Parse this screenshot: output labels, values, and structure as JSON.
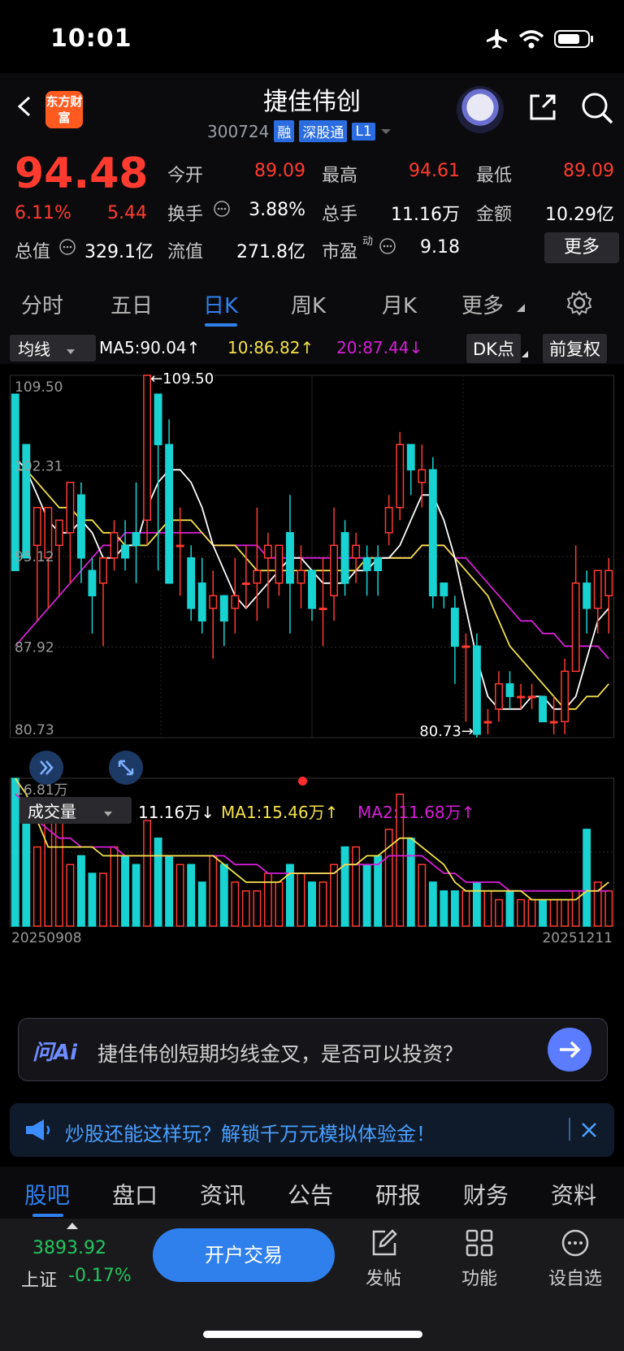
{
  "status_bar": {
    "time": "10:01"
  },
  "header": {
    "logo_text": "东方财富",
    "title": "捷佳伟创",
    "code": "300724",
    "badges": [
      "融",
      "深股通",
      "L1"
    ]
  },
  "quote": {
    "price": "94.48",
    "change_pct": "6.11%",
    "change": "5.44",
    "market_cap_label": "总值",
    "market_cap": "329.1亿",
    "rows": [
      [
        {
          "label": "今开",
          "value": "89.09",
          "color": "#ff3b30"
        },
        {
          "label": "最高",
          "value": "94.61",
          "color": "#ff3b30"
        },
        {
          "label": "最低",
          "value": "89.09",
          "color": "#ff3b30"
        }
      ],
      [
        {
          "label": "换手",
          "value": "3.88%",
          "color": "#ffffff"
        },
        {
          "label": "总手",
          "value": "11.16万",
          "color": "#ffffff"
        },
        {
          "label": "金额",
          "value": "10.29亿",
          "color": "#ffffff"
        }
      ],
      [
        {
          "label": "流值",
          "value": "271.8亿",
          "color": "#ffffff"
        },
        {
          "label": "市盈",
          "value": "9.18",
          "color": "#ffffff"
        }
      ]
    ],
    "pe_superscript": "动",
    "more_label": "更多"
  },
  "kline_tabs": [
    "分时",
    "五日",
    "日K",
    "周K",
    "月K",
    "更多"
  ],
  "kline_active": "日K",
  "ma_legend": {
    "selector": "均线",
    "ma5": "MA5:90.04↑",
    "ma10": "10:86.82↑",
    "ma20": "20:87.44↓",
    "dk_label": "DK点",
    "adjust_label": "前复权"
  },
  "volume_legend": {
    "selector": "成交量",
    "vol": "11.16万↓",
    "ma1": "MA1:15.46万↑",
    "ma2": "MA2:11.68万↑"
  },
  "chart_data": {
    "type": "candlestick",
    "price_axis_labels": [
      "109.50",
      "102.31",
      "95.12",
      "87.92",
      "80.73"
    ],
    "price_range": [
      80.73,
      109.5
    ],
    "annotations": {
      "high": "←109.50",
      "low": "80.73→"
    },
    "volume_axis_label": "16.81万",
    "volume_max": 16.81,
    "date_start": "20250908",
    "date_end": "20251211",
    "colors": {
      "up": "#ff3b30",
      "down": "#19d3d3",
      "ma5": "#ffffff",
      "ma10": "#f3e24b",
      "ma20": "#d61fd6"
    },
    "candles": [
      [
        108,
        94,
        104,
        94
      ],
      [
        104,
        95,
        98,
        96
      ],
      [
        96,
        99,
        98,
        90
      ],
      [
        95,
        99,
        96,
        91
      ],
      [
        96,
        98,
        96,
        92
      ],
      [
        97,
        101,
        98,
        93
      ],
      [
        100,
        95,
        101,
        93
      ],
      [
        94,
        92,
        95,
        89
      ],
      [
        93,
        95,
        95,
        88
      ],
      [
        95,
        97,
        98,
        94
      ],
      [
        96,
        95,
        98,
        94
      ],
      [
        97,
        96,
        101,
        93
      ],
      [
        98,
        109.5,
        109.5,
        96
      ],
      [
        108,
        104,
        108,
        94
      ],
      [
        104,
        93,
        106,
        93
      ],
      [
        96,
        96,
        99,
        92
      ],
      [
        95,
        91,
        96,
        90
      ],
      [
        93,
        90,
        95,
        89
      ],
      [
        91,
        92,
        94,
        87
      ],
      [
        92,
        90,
        92,
        88
      ],
      [
        91,
        92,
        95,
        89
      ],
      [
        93,
        93,
        96,
        91
      ],
      [
        93,
        94,
        99,
        90
      ],
      [
        95,
        96,
        97,
        91
      ],
      [
        93,
        96,
        96,
        92
      ],
      [
        97,
        93,
        100,
        89
      ],
      [
        93,
        94,
        96,
        91
      ],
      [
        94,
        91,
        94,
        90
      ],
      [
        91,
        91,
        95,
        88
      ],
      [
        92,
        96,
        99,
        90
      ],
      [
        97,
        93,
        98,
        92
      ],
      [
        95,
        96,
        97,
        93
      ],
      [
        95,
        94,
        96,
        92
      ],
      [
        95,
        94,
        96,
        92
      ],
      [
        97,
        99,
        100,
        96
      ],
      [
        99,
        104,
        105,
        98
      ],
      [
        104,
        102,
        104,
        100
      ],
      [
        101,
        102,
        104,
        99
      ],
      [
        102,
        92,
        103,
        91
      ],
      [
        93,
        92,
        93,
        91
      ],
      [
        91,
        88,
        92,
        85
      ],
      [
        88,
        88,
        89,
        82
      ],
      [
        88,
        81,
        89,
        80.73
      ],
      [
        82,
        82,
        83,
        81
      ],
      [
        83,
        85,
        86,
        82
      ],
      [
        85,
        84,
        86,
        83
      ],
      [
        84,
        84,
        85,
        83
      ],
      [
        84,
        84,
        85,
        83
      ],
      [
        84,
        82,
        84,
        82
      ],
      [
        82,
        82,
        84,
        81
      ],
      [
        82,
        86,
        87,
        81
      ],
      [
        86,
        93,
        96,
        86
      ],
      [
        93,
        91,
        94,
        89
      ],
      [
        91,
        94,
        94,
        89
      ],
      [
        92,
        94,
        95,
        89
      ]
    ],
    "ma5": [
      103,
      102,
      100,
      98,
      97,
      97,
      98,
      97,
      95,
      95,
      96,
      96,
      99,
      101,
      102,
      102,
      101,
      99,
      96,
      94,
      92,
      91,
      92,
      93,
      94,
      95,
      95,
      94,
      93,
      93,
      93,
      94,
      94,
      95,
      95,
      96,
      98,
      100,
      100,
      98,
      95,
      91,
      87,
      84,
      83,
      83,
      83,
      84,
      84,
      83,
      83,
      84,
      87,
      90,
      91
    ],
    "ma10": [
      102,
      102,
      101,
      100,
      99,
      99,
      98,
      98,
      97,
      97,
      96,
      96,
      96,
      97,
      98,
      98,
      98,
      97,
      96,
      96,
      96,
      95,
      94,
      94,
      94,
      94,
      94,
      94,
      94,
      94,
      94,
      94,
      95,
      95,
      95,
      95,
      95,
      96,
      96,
      96,
      95,
      94,
      93,
      92,
      90,
      88,
      87,
      86,
      85,
      84,
      83,
      83,
      84,
      84,
      85
    ],
    "ma20": [
      88,
      89,
      90,
      91,
      92,
      93,
      94,
      95,
      96,
      96,
      97,
      97,
      97,
      97,
      97,
      97,
      97,
      97,
      96,
      96,
      96,
      96,
      96,
      95,
      95,
      95,
      95,
      95,
      95,
      95,
      95,
      95,
      95,
      95,
      95,
      95,
      95,
      96,
      96,
      96,
      95,
      95,
      94,
      93,
      92,
      91,
      90,
      90,
      89,
      89,
      88,
      88,
      88,
      88,
      87
    ],
    "volumes": [
      16.8,
      14,
      9,
      13,
      12,
      7,
      8,
      6,
      6,
      9,
      8,
      7,
      12,
      10,
      8,
      7,
      7,
      5,
      8,
      7,
      5,
      4,
      4,
      6,
      5,
      7,
      6,
      5,
      5,
      7,
      9,
      9,
      7,
      8,
      11,
      15,
      10,
      7,
      5,
      4,
      4,
      4,
      5,
      4,
      3,
      4,
      3,
      3,
      3,
      3,
      3,
      4,
      11,
      5,
      4
    ],
    "vol_ma1": [
      16.8,
      15,
      12,
      9,
      9,
      9,
      9,
      9,
      8,
      8,
      8,
      8,
      8,
      8,
      8,
      8,
      8,
      8,
      8,
      7,
      6,
      5,
      5,
      5,
      5,
      6,
      6,
      6,
      6,
      6,
      7,
      7,
      8,
      8,
      9,
      10,
      10,
      9,
      8,
      7,
      5,
      4,
      4,
      4,
      4,
      4,
      4,
      3,
      3,
      3,
      3,
      3,
      4,
      4,
      5
    ],
    "vol_ma2": [
      15,
      14,
      12,
      11,
      10,
      10,
      9,
      9,
      9,
      9,
      8,
      8,
      8,
      8,
      8,
      8,
      8,
      8,
      8,
      8,
      7,
      7,
      7,
      6,
      6,
      6,
      6,
      6,
      6,
      6,
      7,
      7,
      7,
      7,
      8,
      8,
      8,
      8,
      7,
      6,
      6,
      5,
      5,
      5,
      5,
      4,
      4,
      4,
      4,
      4,
      4,
      4,
      4,
      4,
      4
    ]
  },
  "ai": {
    "brand": "问Ai",
    "prompt": "捷佳伟创短期均线金叉，是否可以投资？"
  },
  "promo": {
    "text": "炒股还能这样玩？解锁千万元模拟体验金！"
  },
  "bottom_tabs": [
    "股吧",
    "盘口",
    "资讯",
    "公告",
    "研报",
    "财务",
    "资料"
  ],
  "bottom_active": "股吧",
  "footer": {
    "index_value": "3893.92",
    "index_name": "上证",
    "index_change": "-0.17%",
    "open_button": "开户交易",
    "actions": [
      {
        "icon": "edit-icon",
        "label": "发帖"
      },
      {
        "icon": "grid-icon",
        "label": "功能"
      },
      {
        "icon": "more-circle-icon",
        "label": "设自选"
      }
    ]
  }
}
